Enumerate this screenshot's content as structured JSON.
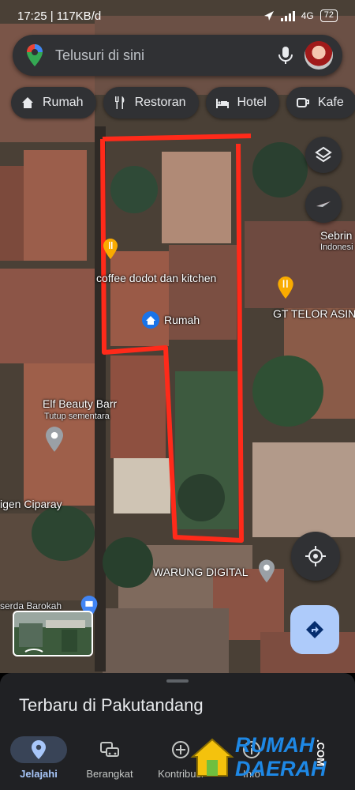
{
  "status_bar": {
    "time_speed": "17:25 | 117KB/d",
    "network": "4G",
    "battery": "72"
  },
  "search": {
    "placeholder": "Telusuri di sini"
  },
  "chips": [
    {
      "label": "Rumah",
      "icon": "home-icon"
    },
    {
      "label": "Restoran",
      "icon": "restaurant-icon"
    },
    {
      "label": "Hotel",
      "icon": "hotel-icon"
    },
    {
      "label": "Kafe",
      "icon": "cafe-icon"
    }
  ],
  "map_labels": {
    "coffee": "coffee dodot dan kitchen",
    "home": "Rumah",
    "gt_telor": "GT TELOR ASIN",
    "sebrin": "Sebrin",
    "indonesia": "Indonesi",
    "elf_title": "Elf Beauty Barr",
    "elf_status": "Tutup sementara",
    "ciparay": "igen Ciparay",
    "warung": "WARUNG DIGITAL",
    "berkah": "serda Barokah"
  },
  "sheet": {
    "title": "Terbaru di Pakutandang"
  },
  "nav": [
    {
      "label": "Jelajahi",
      "icon": "location-pin-icon",
      "active": true
    },
    {
      "label": "Berangkat",
      "icon": "car-icon",
      "active": false
    },
    {
      "label": "Kontribusi",
      "icon": "add-circle-icon",
      "active": false
    },
    {
      "label": "Info",
      "icon": "info-icon",
      "active": false
    }
  ],
  "watermark": {
    "line1": "RUMAH",
    "line2": "DAERAH",
    "suffix": ".COM"
  },
  "colors": {
    "highlight": "#ff2a1a",
    "accent": "#a8c7fa",
    "chip_bg": "#303134",
    "sheet_bg": "#202124"
  }
}
